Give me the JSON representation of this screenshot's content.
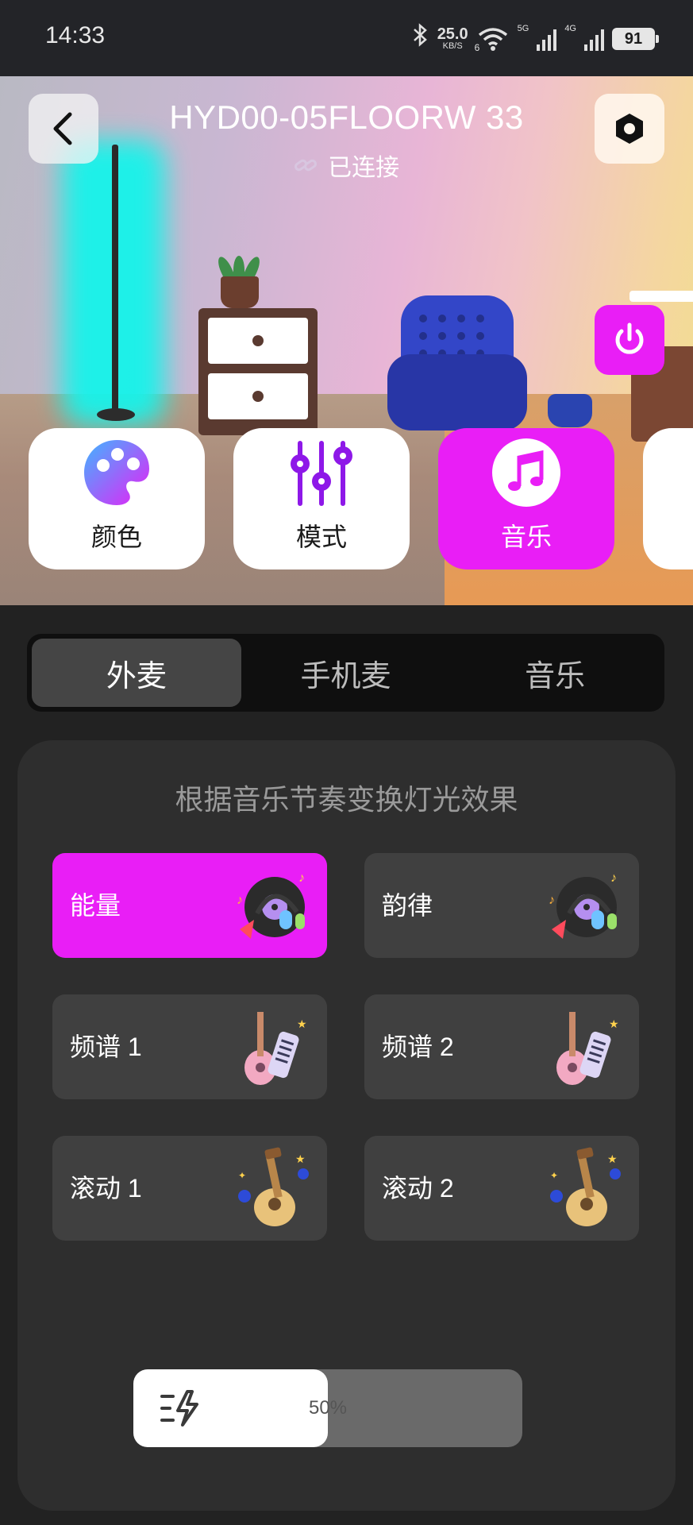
{
  "status_bar": {
    "time": "14:33",
    "speed_value": "25.0",
    "speed_unit": "KB/S",
    "wifi_tag": "6",
    "net1": "5G",
    "net2": "4G",
    "battery": "91",
    "icons": [
      "bluetooth-icon",
      "wifi-icon",
      "signal-5g-icon",
      "signal-4g-icon",
      "battery-icon"
    ]
  },
  "device": {
    "name": "HYD00-05FLOORW 33",
    "status": "已连接"
  },
  "modes": [
    {
      "label": "颜色",
      "icon": "palette-icon",
      "active": false
    },
    {
      "label": "模式",
      "icon": "sliders-icon",
      "active": false
    },
    {
      "label": "音乐",
      "icon": "music-note-icon",
      "active": true
    }
  ],
  "tabs": [
    {
      "label": "外麦",
      "active": true
    },
    {
      "label": "手机麦",
      "active": false
    },
    {
      "label": "音乐",
      "active": false
    }
  ],
  "panel": {
    "subtitle": "根据音乐节奏变换灯光效果",
    "effects": [
      {
        "label": "能量",
        "art": "vinyl-headphones-icon",
        "active": true
      },
      {
        "label": "韵律",
        "art": "vinyl-headphones-icon",
        "active": false
      },
      {
        "label": "频谱 1",
        "art": "ukulele-keyboard-icon",
        "active": false
      },
      {
        "label": "频谱 2",
        "art": "ukulele-keyboard-icon",
        "active": false
      },
      {
        "label": "滚动 1",
        "art": "guitar-icon",
        "active": false
      },
      {
        "label": "滚动 2",
        "art": "guitar-icon",
        "active": false
      }
    ]
  },
  "sensitivity": {
    "value_text": "50%",
    "value": 0.5,
    "icon": "lightning-speed-icon"
  },
  "colors": {
    "accent": "#e91ef6",
    "background": "#222222",
    "panel": "#2e2e2e",
    "card": "#404040"
  }
}
